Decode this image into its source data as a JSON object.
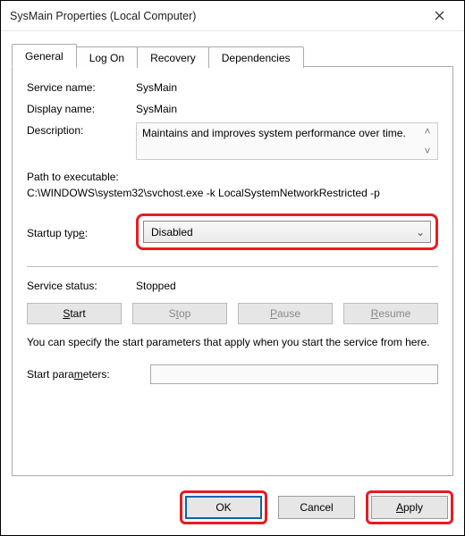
{
  "window": {
    "title": "SysMain Properties (Local Computer)"
  },
  "tabs": {
    "general": "General",
    "logon": "Log On",
    "recovery": "Recovery",
    "dependencies": "Dependencies"
  },
  "general": {
    "service_name_label": "Service name:",
    "service_name_value": "SysMain",
    "display_name_label": "Display name:",
    "display_name_value": "SysMain",
    "description_label": "Description:",
    "description_value": "Maintains and improves system performance over time.",
    "path_label": "Path to executable:",
    "path_value": "C:\\WINDOWS\\system32\\svchost.exe -k LocalSystemNetworkRestricted -p",
    "startup_type_label": "Startup type:",
    "startup_type_value": "Disabled",
    "service_status_label": "Service status:",
    "service_status_value": "Stopped",
    "btn_start": "Start",
    "btn_stop": "Stop",
    "btn_pause": "Pause",
    "btn_resume": "Resume",
    "help_text": "You can specify the start parameters that apply when you start the service from here.",
    "start_params_label": "Start parameters:",
    "start_params_value": ""
  },
  "footer": {
    "ok": "OK",
    "cancel": "Cancel",
    "apply": "Apply"
  },
  "highlight_color": "#e51c23"
}
